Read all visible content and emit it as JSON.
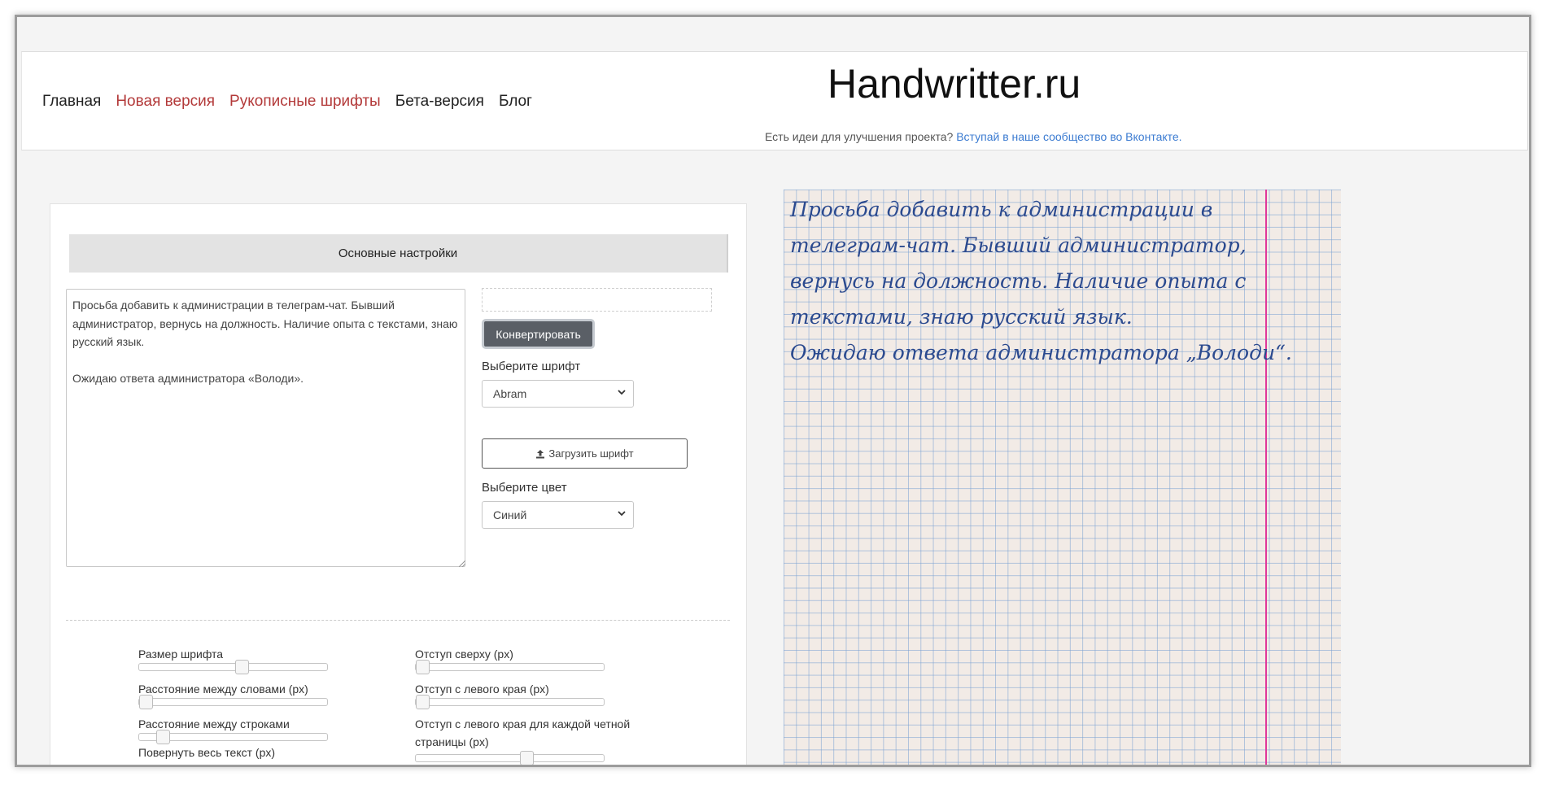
{
  "nav": {
    "items": [
      {
        "label": "Главная"
      },
      {
        "label": "Новая версия"
      },
      {
        "label": "Рукописные шрифты"
      },
      {
        "label": "Бета-версия"
      },
      {
        "label": "Блог"
      }
    ]
  },
  "brand": {
    "title": "Handwritter.ru",
    "tagline_text": "Есть идеи для улучшения проекта?",
    "tagline_link": "Вступай в наше сообщество во Вконтакте."
  },
  "settings": {
    "header": "Основные настройки",
    "text_value": "Просьба добавить к администрации в телеграм-чат. Бывший администратор, вернусь на должность. Наличие опыта с текстами, знаю русский язык.\n\nОжидаю ответа администратора «Володи».",
    "convert_label": "Конвертировать",
    "font_label": "Выберите шрифт",
    "font_value": "Abram",
    "upload_label": "Загрузить шрифт",
    "color_label": "Выберите цвет",
    "color_value": "Синий"
  },
  "sliders": [
    {
      "label": "Размер шрифта",
      "value": 0.55
    },
    {
      "label": "Расстояние между словами (px)",
      "value": 0.0
    },
    {
      "label": "Расстояние между строками",
      "value": 0.1
    },
    {
      "label": "Повернуть весь текст (px)",
      "value": null
    },
    {
      "label": "Отступ сверху (px)",
      "value": 0.0
    },
    {
      "label": "Отступ с левого края (px)",
      "value": 0.0
    },
    {
      "label": "Отступ с левого края для каждой четной страницы (px)",
      "value": 0.6
    }
  ],
  "preview": {
    "lines": [
      "Просьба добавить к администрации в",
      "телеграм-чат. Бывший администратор,",
      "вернусь на должность. Наличие опыта с",
      "текстами, знаю русский язык.",
      "Ожидаю ответа администратора „Володи“."
    ],
    "ink_color": "#2b4a8f",
    "margin_color": "#e0379a",
    "grid_color": "#78a0d2"
  }
}
